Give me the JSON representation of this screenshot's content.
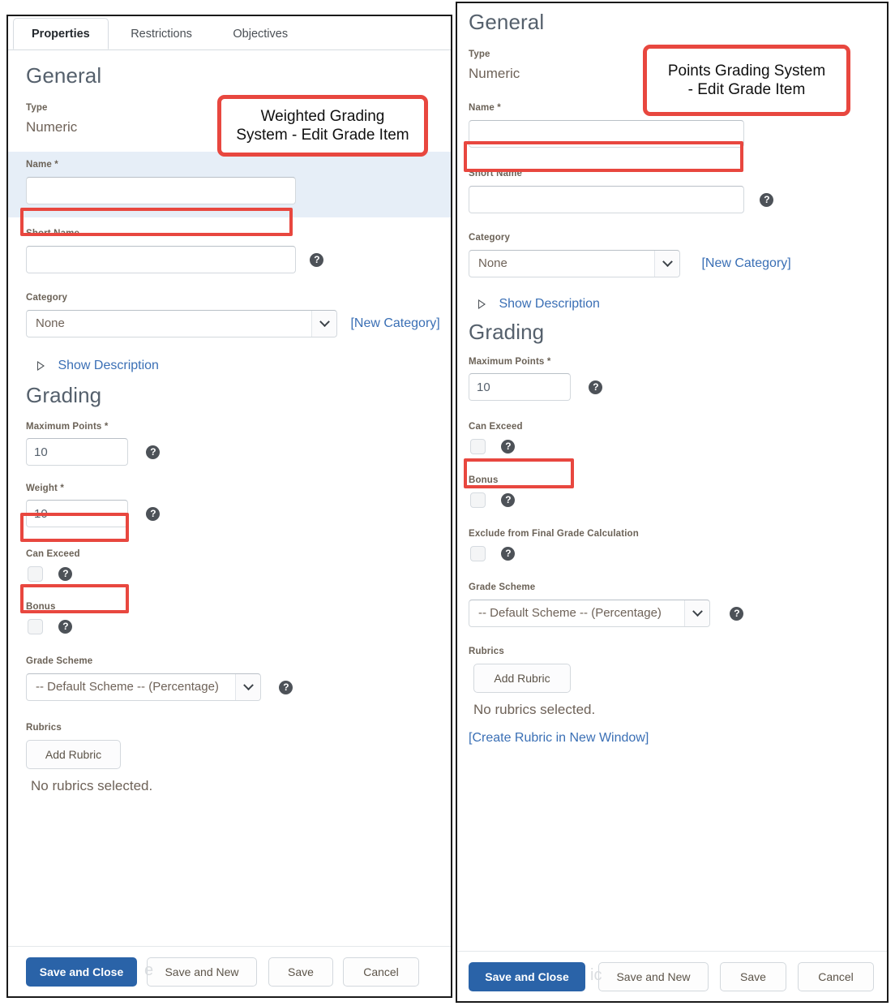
{
  "left_panel": {
    "tabs": [
      {
        "label": "Properties",
        "active": true
      },
      {
        "label": "Restrictions",
        "active": false
      },
      {
        "label": "Objectives",
        "active": false
      }
    ],
    "annotation": "Weighted Grading\nSystem - Edit Grade Item",
    "general_heading": "General",
    "type_label": "Type",
    "type_value": "Numeric",
    "name_label": "Name *",
    "name_value": "",
    "short_name_label": "Short Name",
    "short_name_value": "",
    "category_label": "Category",
    "category_value": "None",
    "new_category_link": "[New Category]",
    "show_description_link": "Show Description",
    "grading_heading": "Grading",
    "maximum_points_label": "Maximum Points *",
    "maximum_points_value": "10",
    "weight_label": "Weight *",
    "weight_value": "10",
    "can_exceed_label": "Can Exceed",
    "bonus_label": "Bonus",
    "grade_scheme_label": "Grade Scheme",
    "grade_scheme_value": "-- Default Scheme -- (Percentage)",
    "rubrics_label": "Rubrics",
    "add_rubric_button": "Add Rubric",
    "no_rubrics_text": "No rubrics selected.",
    "ghost_text": "e",
    "footer_buttons": [
      "Save and Close",
      "Save and New",
      "Save",
      "Cancel"
    ]
  },
  "right_panel": {
    "annotation": "Points Grading System\n- Edit Grade Item",
    "general_heading": "General",
    "type_label": "Type",
    "type_value": "Numeric",
    "name_label": "Name *",
    "name_value": "",
    "short_name_label": "Short Name",
    "short_name_value": "",
    "category_label": "Category",
    "category_value": "None",
    "new_category_link": "[New Category]",
    "show_description_link": "Show Description",
    "grading_heading": "Grading",
    "maximum_points_label": "Maximum Points *",
    "maximum_points_value": "10",
    "can_exceed_label": "Can Exceed",
    "bonus_label": "Bonus",
    "exclude_label": "Exclude from Final Grade Calculation",
    "grade_scheme_label": "Grade Scheme",
    "grade_scheme_value": "-- Default Scheme -- (Percentage)",
    "rubrics_label": "Rubrics",
    "add_rubric_button": "Add Rubric",
    "no_rubrics_text": "No rubrics selected.",
    "create_rubric_link": "[Create Rubric in New Window]",
    "ghost_text": "ic",
    "footer_buttons": [
      "Save and Close",
      "Save and New",
      "Save",
      "Cancel"
    ]
  },
  "icons": {
    "help": "?",
    "chevron_down": "chevron-down-icon",
    "disclosure_triangle": "triangle-right-icon"
  },
  "colors": {
    "annotation_red": "#e8473f",
    "primary_blue": "#2a63a8",
    "link_blue": "#3a6fb5",
    "name_band": "#e6eef7"
  }
}
